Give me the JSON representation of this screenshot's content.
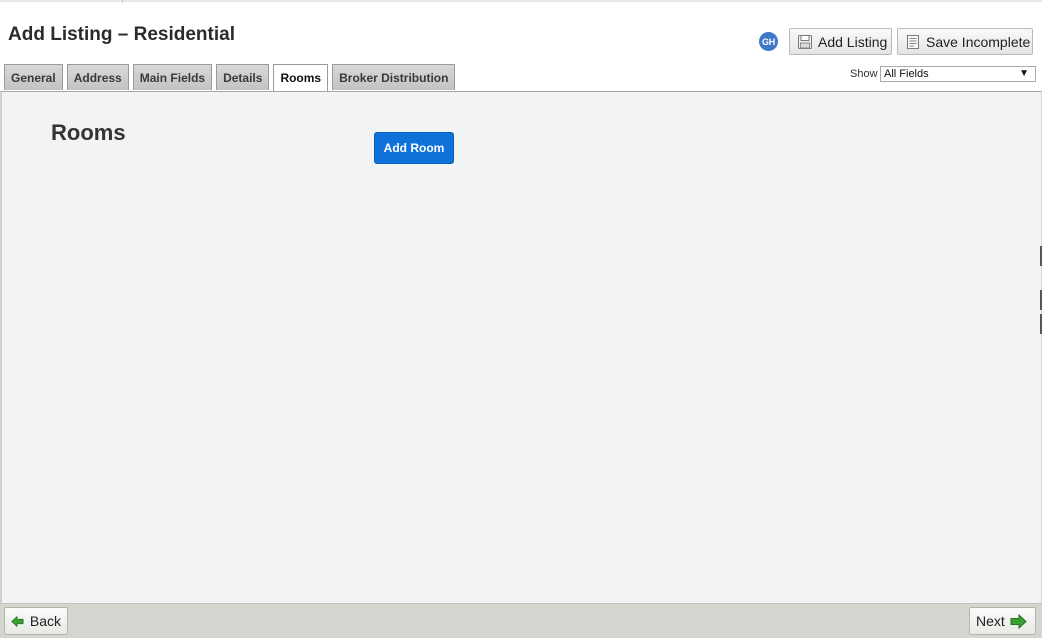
{
  "page": {
    "title": "Add Listing – Residential"
  },
  "user": {
    "initials": "GH",
    "avatar_color": "#3f78c8"
  },
  "toolbar": {
    "add_listing_label": "Add Listing",
    "add_listing_icon": "disk-icon",
    "save_incomplete_label": "Save Incomplete",
    "save_incomplete_icon": "document-icon"
  },
  "tabs": [
    {
      "label": "General",
      "active": false
    },
    {
      "label": "Address",
      "active": false
    },
    {
      "label": "Main Fields",
      "active": false
    },
    {
      "label": "Details",
      "active": false
    },
    {
      "label": "Rooms",
      "active": true
    },
    {
      "label": "Broker Distribution",
      "active": false
    }
  ],
  "show_filter": {
    "label": "Show",
    "selected": "All Fields"
  },
  "rooms": {
    "heading": "Rooms",
    "add_button_label": "Add Room",
    "button_color": "#0f72d9"
  },
  "footer": {
    "back_label": "Back",
    "next_label": "Next",
    "arrow_color": "#3aa032"
  }
}
